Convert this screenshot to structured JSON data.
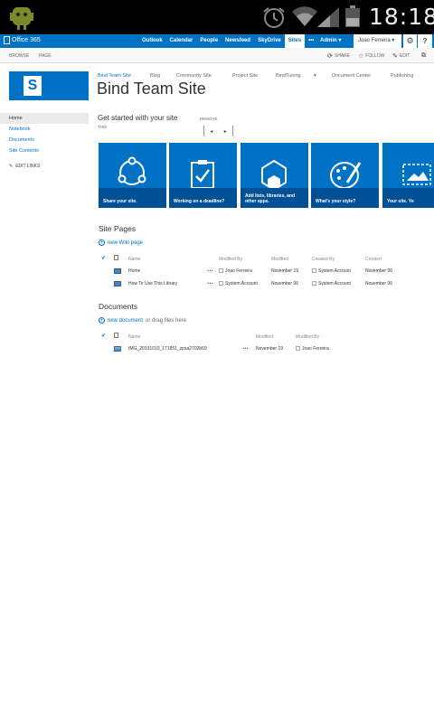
{
  "statusbar": {
    "time": "18:18"
  },
  "suitebar": {
    "brand": "Office 365",
    "nav": [
      "Outlook",
      "Calendar",
      "People",
      "Newsfeed",
      "SkyDrive",
      "Sites",
      "•••"
    ],
    "admin": "Admin ▾",
    "user": "Joao Ferreira ▾",
    "gear_icon": "⚙",
    "help_icon": "?"
  },
  "ribbon": {
    "browse": "BROWSE",
    "page": "PAGE",
    "share": "SHARE",
    "follow": "FOLLOW",
    "edit": "EDIT"
  },
  "site": {
    "logo_letter": "S",
    "title": "Bind Team Site",
    "topnav": [
      "Bind Team Site",
      "Blog",
      "Community Site",
      "Project Site",
      "BindTuning",
      "Document Center",
      "Publishing"
    ]
  },
  "quicklaunch": {
    "items": [
      "Home",
      "Notebook",
      "Documents",
      "Site Contents"
    ],
    "edit_links": "EDIT LINKS"
  },
  "getstarted": {
    "title": "Get started with your site",
    "remove": "REMOVE",
    "this": "THIS",
    "tiles": [
      "Share your site.",
      "Working on a deadline?",
      "Add lists, libraries, and other apps.",
      "What's your style?",
      "Your site. Yo"
    ]
  },
  "site_pages": {
    "heading": "Site Pages",
    "new_link": "new Wiki page",
    "columns": [
      "Name",
      "Modified By",
      "Modified",
      "Created By",
      "Created"
    ],
    "rows": [
      {
        "name": "Home",
        "modified_by": "Joao Ferreira",
        "modified": "November 19",
        "created_by": "System Account",
        "created": "November 06"
      },
      {
        "name": "How To Use This Library",
        "modified_by": "System Account",
        "modified": "November 06",
        "created_by": "System Account",
        "created": "November 06"
      }
    ]
  },
  "documents": {
    "heading": "Documents",
    "new_link": "new document",
    "new_rest": "or drag files here",
    "columns": [
      "Name",
      "Modified",
      "Modified By"
    ],
    "rows": [
      {
        "name": "IMG_20131010_171851_zpsa2702b59",
        "modified": "November 19",
        "modified_by": "Joao Ferreira"
      }
    ]
  },
  "colors": {
    "brand_blue": "#0072c6",
    "statusbar": "#000000"
  }
}
